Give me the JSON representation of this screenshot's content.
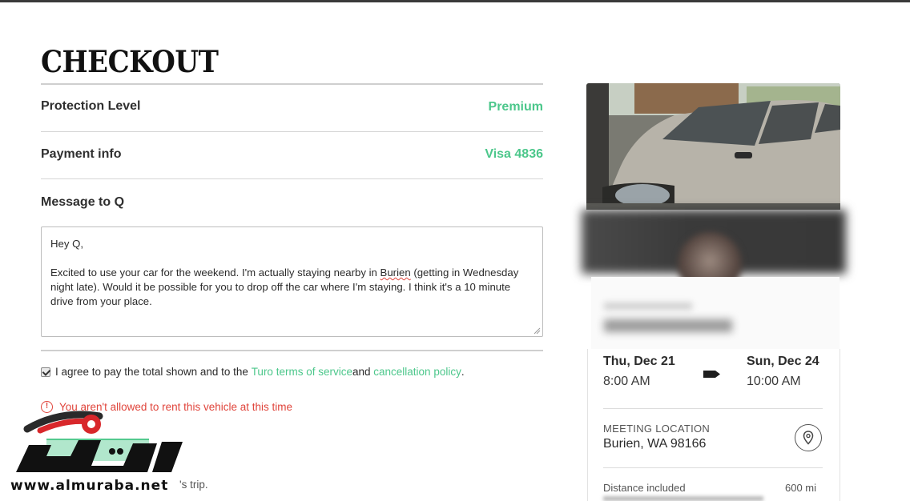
{
  "page": {
    "title": "CHECKOUT"
  },
  "rows": [
    {
      "label": "Protection Level",
      "value": "Premium"
    },
    {
      "label": "Payment info",
      "value": "Visa 4836"
    }
  ],
  "message": {
    "label": "Message to Q",
    "greeting": "Hey Q,",
    "body_pre": "Excited to use your car for the weekend. I'm actually staying nearby in ",
    "body_misspelled": "Burien",
    "body_post": " (getting in Wednesday night late). Would it be possible for you to drop off the car where I'm staying. I think   it's a 10 minute drive from your place."
  },
  "agreement": {
    "checked": true,
    "text_pre": "I agree to pay the total shown and to the ",
    "link1": "Turo terms of service",
    "text_mid": " and ",
    "link2": "cancellation policy",
    "text_post": "."
  },
  "error": {
    "icon": "!",
    "text": "You aren't allowed to rent this vehicle at this time"
  },
  "trip_note": "'s trip.",
  "watermark": {
    "url": "www.almuraba.net",
    "logo_text": "المربع نت"
  },
  "trip": {
    "start_date": "Thu, Dec 21",
    "start_time": "8:00 AM",
    "end_date": "Sun, Dec 24",
    "end_time": "10:00 AM",
    "meeting_label": "MEETING LOCATION",
    "meeting_value": "Burien, WA 98166",
    "distance_label": "Distance included",
    "distance_value": "600 mi"
  },
  "colors": {
    "accent": "#4cc78b",
    "error": "#e0443b"
  },
  "icons": {
    "pin": "location-pin-icon",
    "arrow": "arrow-right-icon",
    "error": "error-icon"
  }
}
